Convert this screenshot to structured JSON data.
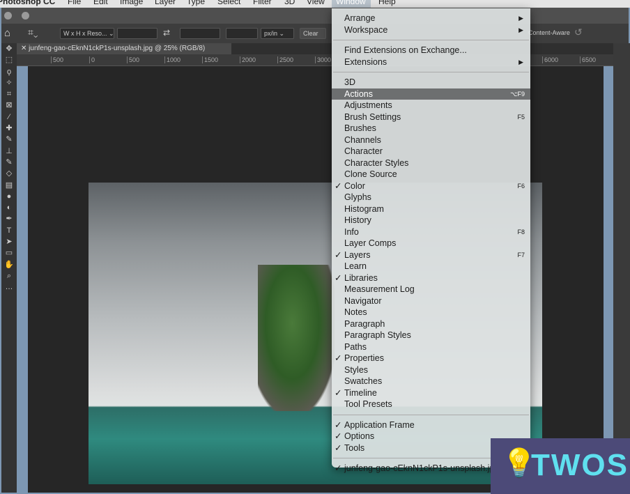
{
  "menubar": {
    "app": "Photoshop CC",
    "items": [
      "File",
      "Edit",
      "Image",
      "Layer",
      "Type",
      "Select",
      "Filter",
      "3D",
      "View",
      "Window",
      "Help"
    ]
  },
  "options": {
    "ratio": "W x H x Reso...",
    "units": "px/in",
    "clear": "Clear",
    "content_aware": "Content-Aware"
  },
  "document": {
    "tab": "junfeng-gao-cEknN1ckP1s-unsplash.jpg @ 25% (RGB/8)"
  },
  "ruler": [
    "500",
    "0",
    "500",
    "1000",
    "1500",
    "2000",
    "2500",
    "3000",
    "6000",
    "6500"
  ],
  "window_menu": {
    "sections": [
      [
        {
          "label": "Arrange",
          "submenu": true
        },
        {
          "label": "Workspace",
          "submenu": true
        }
      ],
      [
        {
          "label": "Find Extensions on Exchange..."
        },
        {
          "label": "Extensions",
          "submenu": true
        }
      ],
      [
        {
          "label": "3D"
        },
        {
          "label": "Actions",
          "shortcut": "⌥F9",
          "highlighted": true
        },
        {
          "label": "Adjustments"
        },
        {
          "label": "Brush Settings",
          "shortcut": "F5"
        },
        {
          "label": "Brushes"
        },
        {
          "label": "Channels"
        },
        {
          "label": "Character"
        },
        {
          "label": "Character Styles"
        },
        {
          "label": "Clone Source"
        },
        {
          "label": "Color",
          "checked": true,
          "shortcut": "F6"
        },
        {
          "label": "Glyphs"
        },
        {
          "label": "Histogram"
        },
        {
          "label": "History"
        },
        {
          "label": "Info",
          "shortcut": "F8"
        },
        {
          "label": "Layer Comps"
        },
        {
          "label": "Layers",
          "checked": true,
          "shortcut": "F7"
        },
        {
          "label": "Learn"
        },
        {
          "label": "Libraries",
          "checked": true
        },
        {
          "label": "Measurement Log"
        },
        {
          "label": "Navigator"
        },
        {
          "label": "Notes"
        },
        {
          "label": "Paragraph"
        },
        {
          "label": "Paragraph Styles"
        },
        {
          "label": "Paths"
        },
        {
          "label": "Properties",
          "checked": true
        },
        {
          "label": "Styles"
        },
        {
          "label": "Swatches"
        },
        {
          "label": "Timeline",
          "checked": true
        },
        {
          "label": "Tool Presets"
        }
      ],
      [
        {
          "label": "Application Frame",
          "checked": true
        },
        {
          "label": "Options",
          "checked": true
        },
        {
          "label": "Tools",
          "checked": true
        }
      ],
      [
        {
          "label": "junfeng-gao-cEknN1ckP1s-unsplash.jpg",
          "checked": true
        }
      ]
    ]
  },
  "watermark": {
    "text": "TWOS"
  }
}
